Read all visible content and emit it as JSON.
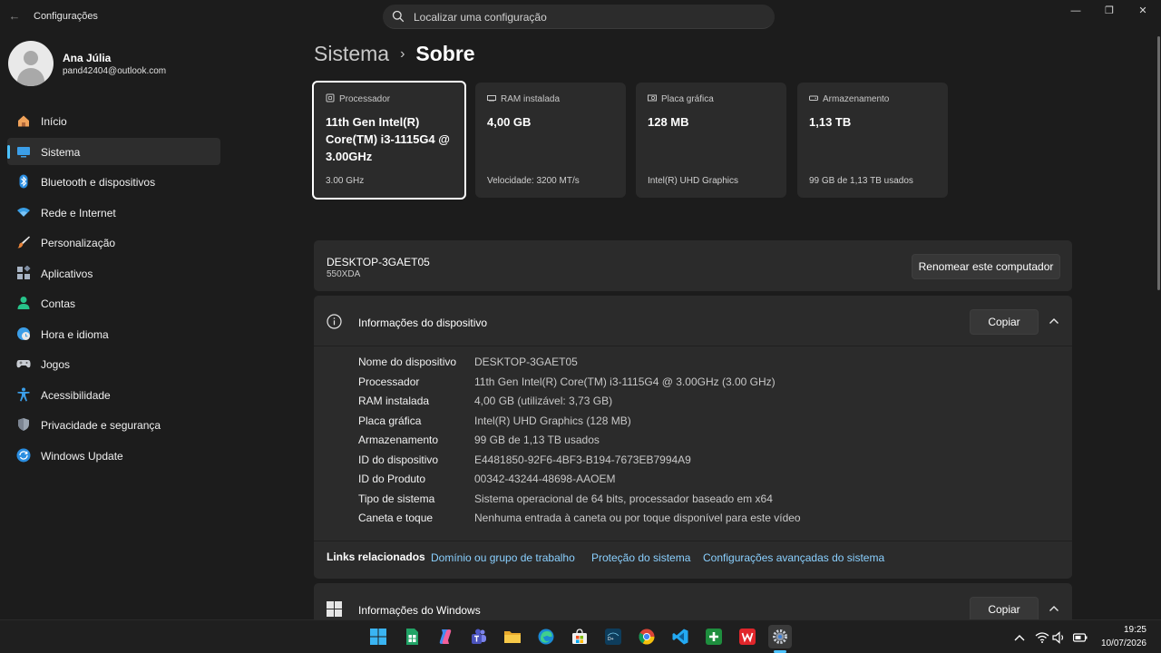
{
  "window": {
    "title": "Configurações",
    "search_placeholder": "Localizar uma configuração"
  },
  "user": {
    "name": "Ana Júlia",
    "email": "pand42404@outlook.com"
  },
  "sidebar": {
    "items": [
      {
        "label": "Início",
        "icon": "home-icon"
      },
      {
        "label": "Sistema",
        "icon": "system-icon",
        "active": true
      },
      {
        "label": "Bluetooth e dispositivos",
        "icon": "bluetooth-icon"
      },
      {
        "label": "Rede e Internet",
        "icon": "wifi-icon"
      },
      {
        "label": "Personalização",
        "icon": "brush-icon"
      },
      {
        "label": "Aplicativos",
        "icon": "apps-icon"
      },
      {
        "label": "Contas",
        "icon": "account-icon"
      },
      {
        "label": "Hora e idioma",
        "icon": "globe-clock-icon"
      },
      {
        "label": "Jogos",
        "icon": "gamepad-icon"
      },
      {
        "label": "Acessibilidade",
        "icon": "accessibility-icon"
      },
      {
        "label": "Privacidade e segurança",
        "icon": "shield-icon"
      },
      {
        "label": "Windows Update",
        "icon": "update-icon"
      }
    ]
  },
  "breadcrumb": {
    "parent": "Sistema",
    "separator": "›",
    "current": "Sobre"
  },
  "cards": [
    {
      "title": "Processador",
      "value": "11th Gen Intel(R) Core(TM) i3-1115G4 @ 3.00GHz",
      "footer": "3.00 GHz"
    },
    {
      "title": "RAM instalada",
      "value": "4,00 GB",
      "footer": "Velocidade: 3200 MT/s"
    },
    {
      "title": "Placa gráfica",
      "value": "128 MB",
      "footer": "Intel(R) UHD Graphics"
    },
    {
      "title": "Armazenamento",
      "value": "1,13 TB",
      "footer": "99 GB de 1,13 TB usados"
    }
  ],
  "computer": {
    "name": "DESKTOP-3GAET05",
    "model": "550XDA",
    "rename_label": "Renomear este computador"
  },
  "device_info": {
    "title": "Informações do dispositivo",
    "copy_label": "Copiar",
    "rows": [
      {
        "key": "Nome do dispositivo",
        "value": "DESKTOP-3GAET05"
      },
      {
        "key": "Processador",
        "value": "11th Gen Intel(R) Core(TM) i3-1115G4 @ 3.00GHz (3.00 GHz)"
      },
      {
        "key": "RAM instalada",
        "value": "4,00 GB (utilizável: 3,73 GB)"
      },
      {
        "key": "Placa gráfica",
        "value": "Intel(R) UHD Graphics (128 MB)"
      },
      {
        "key": "Armazenamento",
        "value": "99 GB de 1,13 TB usados"
      },
      {
        "key": "ID do dispositivo",
        "value": "E4481850-92F6-4BF3-B194-7673EB7994A9"
      },
      {
        "key": "ID do Produto",
        "value": "00342-43244-48698-AAOEM"
      },
      {
        "key": "Tipo de sistema",
        "value": "Sistema operacional de 64 bits, processador baseado em x64"
      },
      {
        "key": "Caneta e toque",
        "value": "Nenhuma entrada à caneta ou por toque disponível para este vídeo"
      }
    ]
  },
  "related_links": {
    "label": "Links relacionados",
    "links": [
      "Domínio ou grupo de trabalho",
      "Proteção do sistema",
      "Configurações avançadas do sistema"
    ]
  },
  "windows_info": {
    "title": "Informações do Windows",
    "copy_label": "Copiar"
  },
  "taskbar": {
    "apps": [
      "start-icon",
      "sheets-icon",
      "copilot-icon",
      "teams-icon",
      "file-explorer-icon",
      "edge-icon",
      "store-icon",
      "disney-plus-icon",
      "chrome-icon",
      "vscode-icon",
      "plus-app-icon",
      "wps-icon",
      "settings-icon"
    ],
    "time": "19:25",
    "date": "10/07/2026"
  },
  "colors": {
    "background": "#1c1c1c",
    "card": "#2b2b2b",
    "accent": "#4cc2ff",
    "link": "#8ad0ff"
  }
}
